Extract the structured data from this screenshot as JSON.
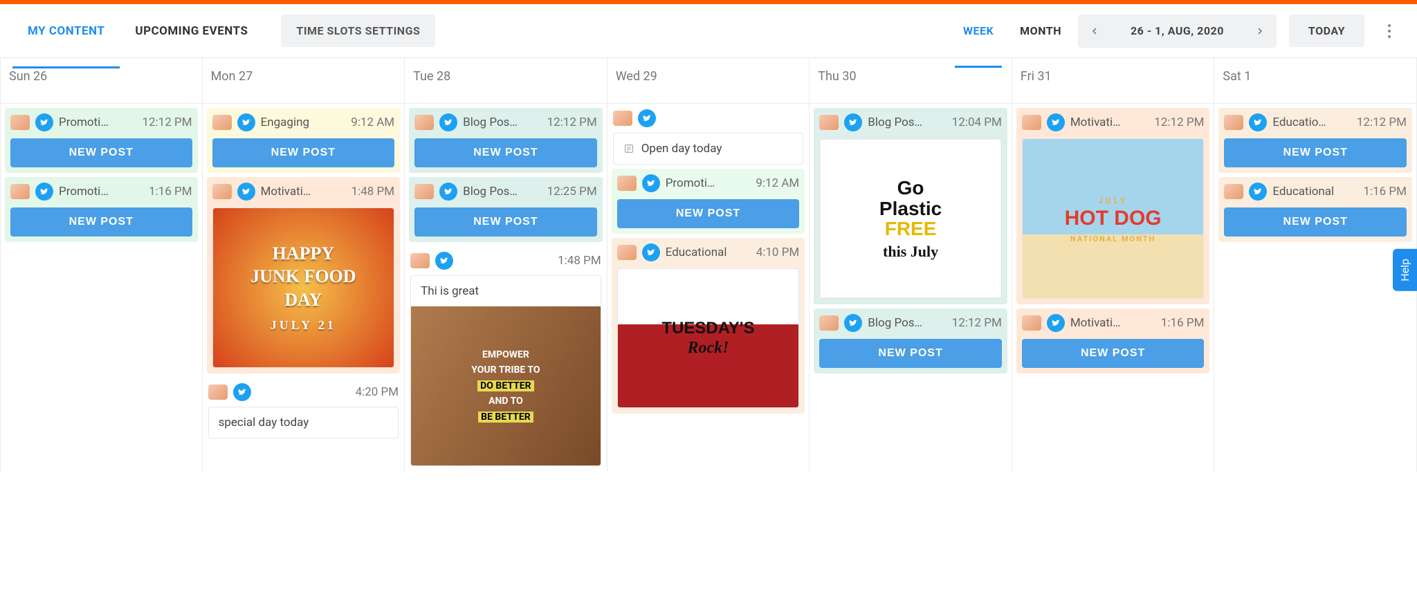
{
  "tabs": {
    "my_content": "MY CONTENT",
    "upcoming": "UPCOMING EVENTS"
  },
  "time_slots_button": "TIME SLOTS SETTINGS",
  "view": {
    "week": "WEEK",
    "month": "MONTH"
  },
  "date_range": "26 - 1, AUG, 2020",
  "today_button": "TODAY",
  "new_post_label": "NEW POST",
  "help_label": "Help",
  "days": {
    "sun": {
      "label": "Sun 26"
    },
    "mon": {
      "label": "Mon 27"
    },
    "tue": {
      "label": "Tue 28"
    },
    "wed": {
      "label": "Wed 29"
    },
    "thu": {
      "label": "Thu 30"
    },
    "fri": {
      "label": "Fri 31"
    },
    "sat": {
      "label": "Sat 1"
    }
  },
  "cards": {
    "sun1": {
      "label": "Promoti…",
      "time": "12:12 PM"
    },
    "sun2": {
      "label": "Promoti…",
      "time": "1:16 PM"
    },
    "mon1": {
      "label": "Engaging",
      "time": "9:12 AM"
    },
    "mon2": {
      "label": "Motivati…",
      "time": "1:48 PM"
    },
    "mon3": {
      "time": "4:20 PM",
      "text": "special day today"
    },
    "tue1": {
      "label": "Blog Pos…",
      "time": "12:12 PM"
    },
    "tue2": {
      "label": "Blog Pos…",
      "time": "12:25 PM"
    },
    "tue3": {
      "time": "1:48 PM",
      "text": "Thi is great"
    },
    "wed_note": "Open day today",
    "wed1": {
      "label": "Promoti…",
      "time": "9:12 AM"
    },
    "wed2": {
      "label": "Educational",
      "time": "4:10 PM"
    },
    "thu1": {
      "label": "Blog Pos…",
      "time": "12:04 PM"
    },
    "thu2": {
      "label": "Blog Pos…",
      "time": "12:12 PM"
    },
    "fri1": {
      "label": "Motivati…",
      "time": "12:12 PM"
    },
    "fri2": {
      "label": "Motivati…",
      "time": "1:16 PM"
    },
    "sat1": {
      "label": "Educatio…",
      "time": "12:12 PM"
    },
    "sat2": {
      "label": "Educational",
      "time": "1:16 PM"
    }
  },
  "images": {
    "junkfood": {
      "line1": "HAPPY",
      "line2": "JUNK FOOD",
      "line3": "DAY",
      "sub": "JULY 21"
    },
    "bebetter": {
      "l1": "EMPOWER",
      "l2": "YOUR TRIBE TO",
      "l3": "DO BETTER",
      "l4": "AND TO",
      "l5": "BE BETTER"
    },
    "tuesday": {
      "l1": "TUESDAY'S",
      "l2": "Rock!"
    },
    "plastic": {
      "l1": "Go",
      "l2": "Plastic",
      "l3": "FREE",
      "l4": "this July"
    },
    "hotdog": {
      "l1": "JULY",
      "l2": "HOT DOG",
      "l3": "NATIONAL MONTH"
    }
  }
}
